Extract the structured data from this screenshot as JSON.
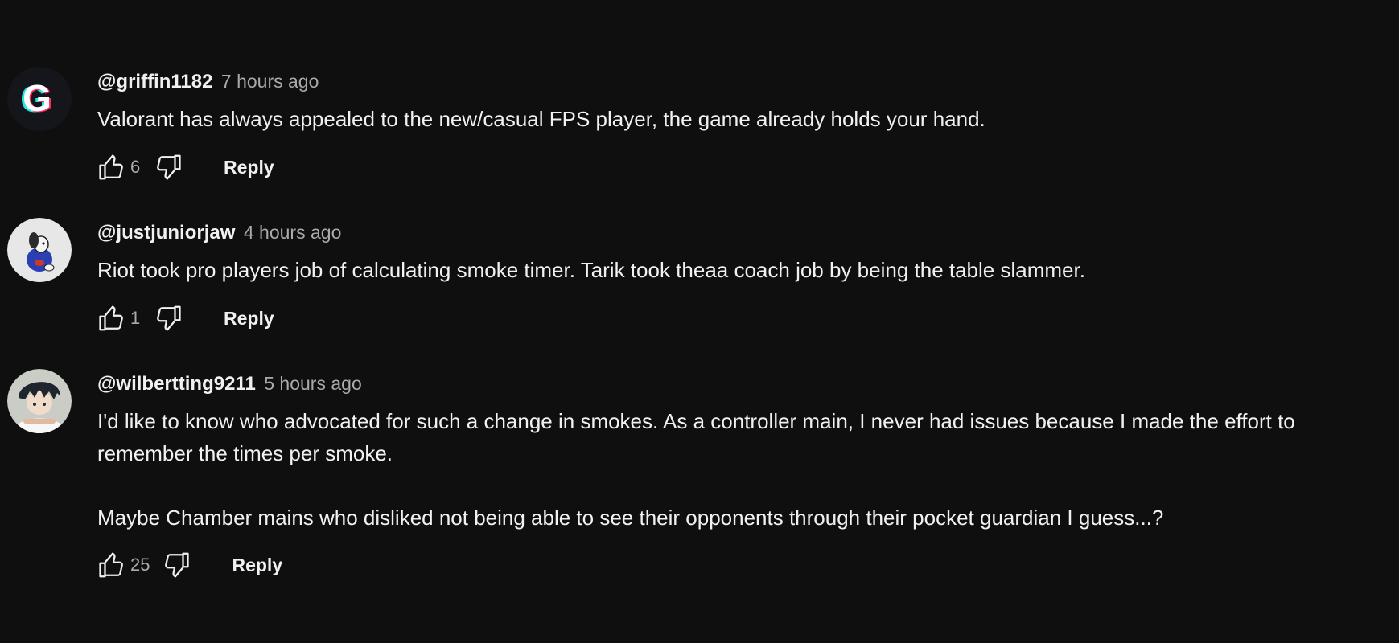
{
  "comments": [
    {
      "author": "@griffin1182",
      "time": "7 hours ago",
      "text": "Valorant has always appealed to the new/casual FPS player, the game already holds your hand.",
      "likes": "6",
      "reply_label": "Reply",
      "avatar_letter": "G"
    },
    {
      "author": "@justjuniorjaw",
      "time": "4 hours ago",
      "text": "Riot took pro players job of calculating smoke timer. Tarik took theaa coach job by being the table slammer.",
      "likes": "1",
      "reply_label": "Reply"
    },
    {
      "author": "@wilbertting9211",
      "time": "5 hours ago",
      "text": "I'd like to know who advocated for such a change in smokes. As a controller main, I never had issues because I made the effort to remember the times per smoke.\n\nMaybe Chamber mains who disliked not being able to see their opponents through their pocket guardian I guess...?",
      "likes": "25",
      "reply_label": "Reply"
    }
  ],
  "colors": {
    "background": "#0f0f0f",
    "primary_text": "#f1f1f1",
    "secondary_text": "#aaaaaa"
  },
  "icons": [
    "thumbs-up-icon",
    "thumbs-down-icon"
  ]
}
